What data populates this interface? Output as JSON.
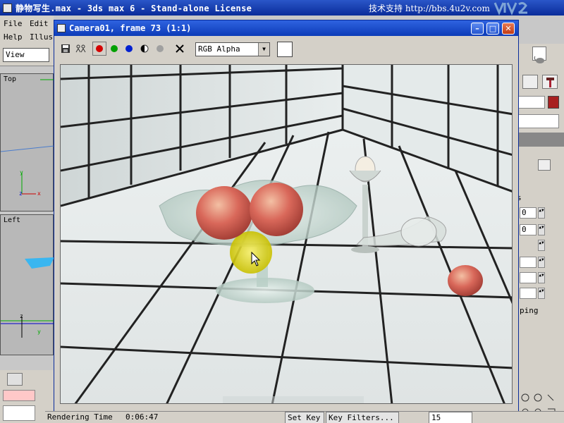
{
  "app": {
    "title": "静物写生.max - 3ds max 6 - Stand-alone License",
    "site": "技术支持 http://bbs.4u2v.com"
  },
  "menus": {
    "file": "File",
    "edit": "Edit",
    "help": "Help",
    "illus": "Illus"
  },
  "left": {
    "view_select": "View",
    "viewport_top": "Top",
    "viewport_left": "Left"
  },
  "render_window": {
    "title": "Camera01, frame 73 (1:1)",
    "channel": "RGB Alpha"
  },
  "right_panel": {
    "field_1": "0",
    "field_2": "0",
    "label_s": "s",
    "label_ping": "ping"
  },
  "status": {
    "render_time_label": "Rendering Time",
    "render_time_value": "0:06:47",
    "set_key": "Set Key",
    "key_filters": "Key Filters...",
    "frame_field": "15"
  },
  "colors": {
    "title_blue": "#0a2c9a",
    "red_channel": "#d40000",
    "green_channel": "#00a000",
    "blue_channel": "#0020d0"
  }
}
